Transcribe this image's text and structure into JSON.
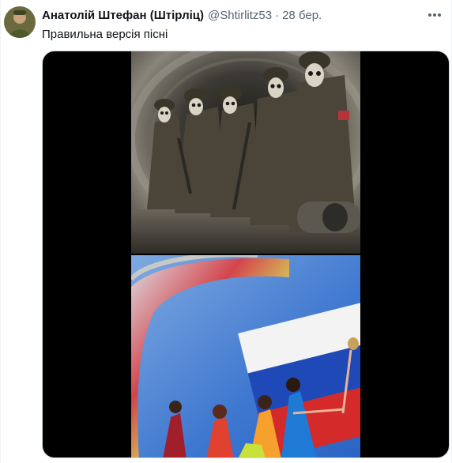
{
  "tweet": {
    "author_name": "Анатолій Штефан (Штірліц)",
    "handle": "@Shtirlitz53",
    "separator": "·",
    "date": "28 бер.",
    "text": "Правильна версія пісні"
  },
  "icons": {
    "avatar": "avatar-photo",
    "more": "more-horizontal-icon"
  },
  "colors": {
    "text_primary": "#0f1419",
    "text_secondary": "#536471",
    "media_bg": "#000000",
    "border": "#cfd9de"
  }
}
